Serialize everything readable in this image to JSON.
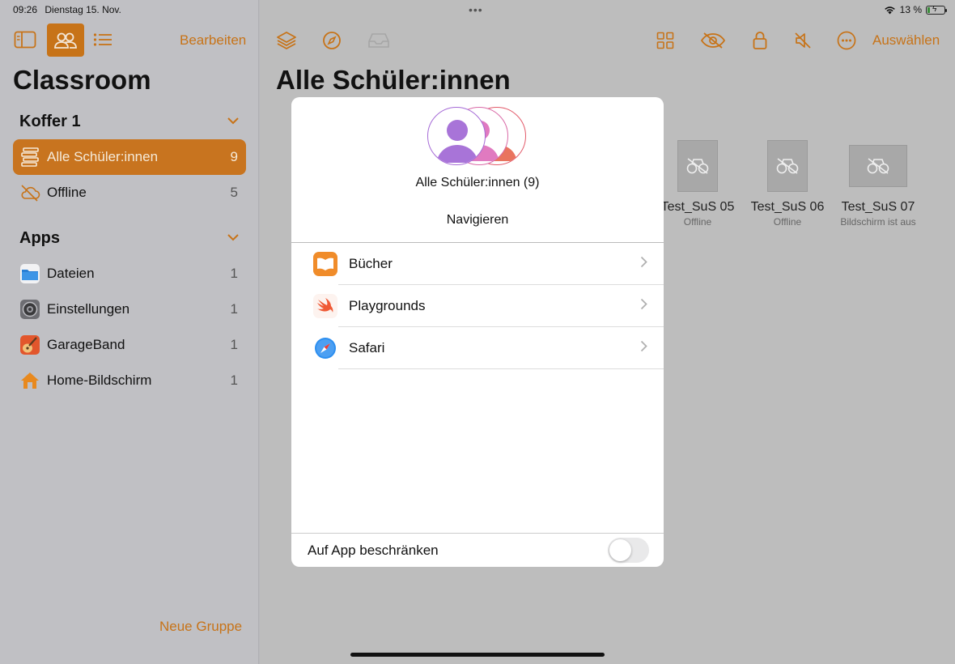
{
  "status_bar": {
    "time": "09:26",
    "date": "Dienstag 15. Nov.",
    "battery_label": "13 %",
    "battery_level": 0.13,
    "battery_bolt": "ϟ"
  },
  "sidebar": {
    "edit_label": "Bearbeiten",
    "title": "Classroom",
    "group_section": "Koffer 1",
    "group_items": [
      {
        "label": "Alle Schüler:innen",
        "count": "9",
        "icon": "students-stack-icon",
        "selected": true
      },
      {
        "label": "Offline",
        "count": "5",
        "icon": "cloud-offline-icon",
        "selected": false
      }
    ],
    "apps_section": "Apps",
    "app_items": [
      {
        "label": "Dateien",
        "count": "1",
        "icon": "files-app-icon"
      },
      {
        "label": "Einstellungen",
        "count": "1",
        "icon": "settings-app-icon"
      },
      {
        "label": "GarageBand",
        "count": "1",
        "icon": "garageband-app-icon"
      },
      {
        "label": "Home-Bildschirm",
        "count": "1",
        "icon": "home-icon"
      }
    ],
    "new_group_label": "Neue Gruppe"
  },
  "main": {
    "title": "Alle Schüler:innen",
    "select_label": "Auswählen",
    "students": [
      {
        "name": "Test_SuS 05",
        "status": "Offline"
      },
      {
        "name": "Test_SuS 06",
        "status": "Offline"
      },
      {
        "name": "Test_SuS 07",
        "status": "Bildschirm ist aus"
      }
    ]
  },
  "popover": {
    "caption": "Alle Schüler:innen (9)",
    "navigate_label": "Navigieren",
    "apps": [
      {
        "label": "Bücher",
        "icon": "books-app-icon"
      },
      {
        "label": "Playgrounds",
        "icon": "swift-playgrounds-icon"
      },
      {
        "label": "Safari",
        "icon": "safari-compass-icon"
      }
    ],
    "restrict_label": "Auf App beschränken",
    "restrict_on": false
  },
  "colors": {
    "accent": "#c77318",
    "sidebar_bg": "#c0c0c4",
    "main_bg": "#bdbdbd"
  }
}
